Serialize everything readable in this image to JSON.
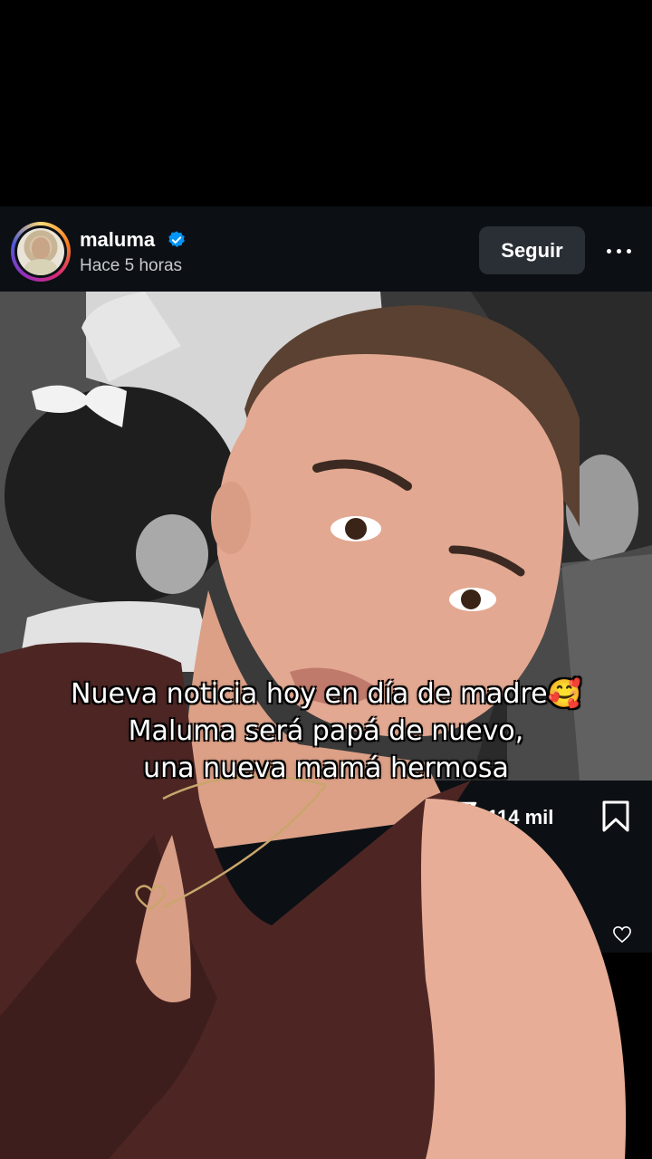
{
  "post": {
    "username": "maluma",
    "verified": true,
    "time": "Hace 5 horas",
    "follow_label": "Seguir",
    "likes_count": "114 mil"
  },
  "caption": {
    "line1": "Nueva noticia hoy en día de madre🥰",
    "line2": "Maluma será papá de nuevo,",
    "line3": "una nueva mamá hermosa"
  },
  "colors": {
    "header_bg": "#0c1014",
    "follow_bg": "#2a2f36",
    "verified_blue": "#0095f6"
  },
  "icons": [
    "verified-badge-icon",
    "more-options-icon",
    "share-icon",
    "bookmark-icon",
    "heart-icon"
  ]
}
